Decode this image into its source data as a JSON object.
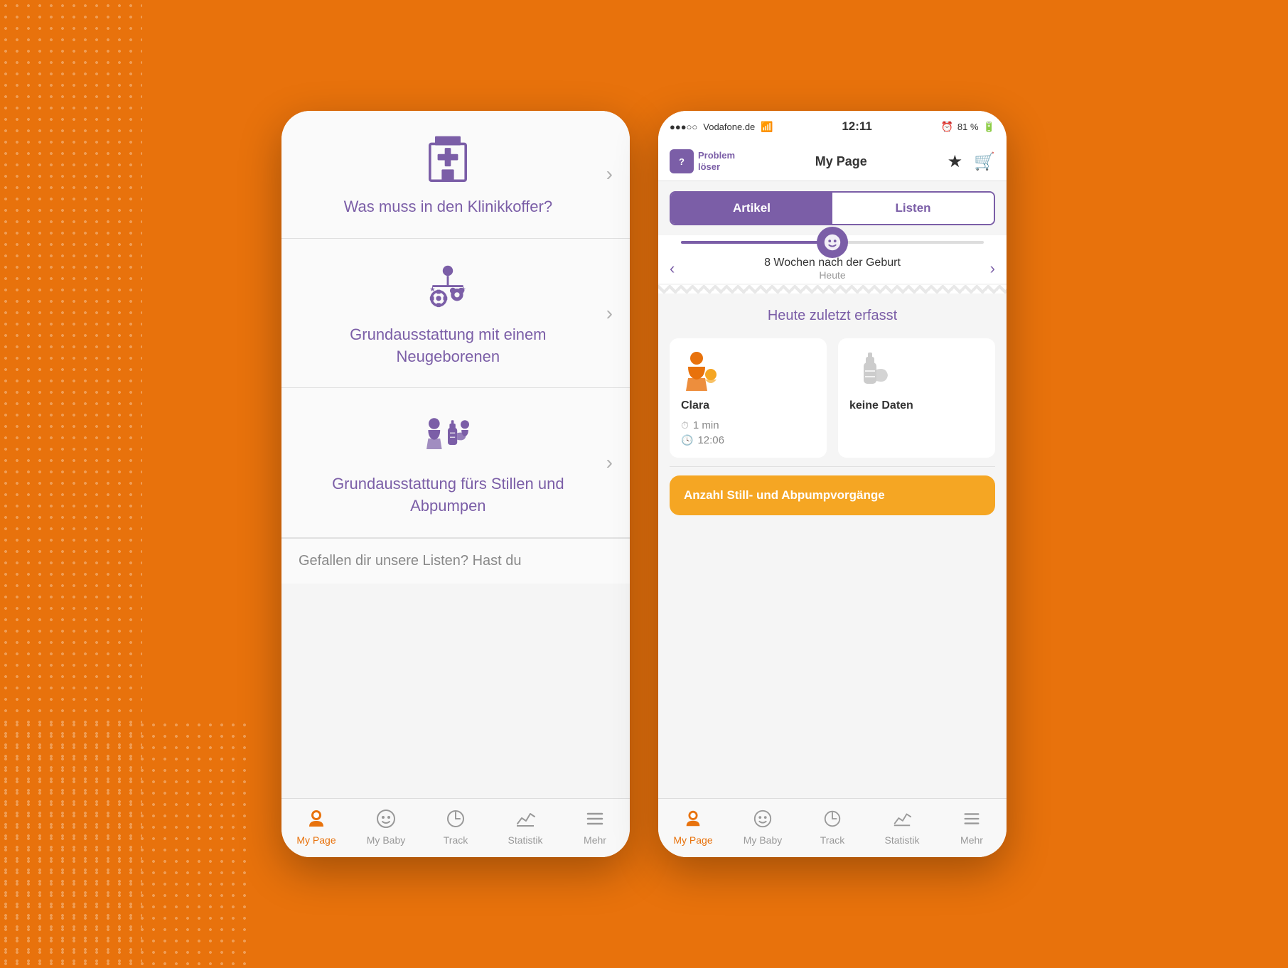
{
  "background_color": "#E8720C",
  "left_phone": {
    "items": [
      {
        "icon": "hospital",
        "label": "Was muss in den\nKlinikkoffer?"
      },
      {
        "icon": "baby-mobile",
        "label": "Grundausstattung mit\neinem Neugeborenen"
      },
      {
        "icon": "breastpump",
        "label": "Grundausstattung fürs\nStillen und Abpumpen"
      }
    ],
    "bottom_text": "Gefallen dir unsere Listen? Hast du",
    "nav": {
      "items": [
        {
          "label": "My Page",
          "active": true
        },
        {
          "label": "My Baby",
          "active": false
        },
        {
          "label": "Track",
          "active": false
        },
        {
          "label": "Statistik",
          "active": false
        },
        {
          "label": "Mehr",
          "active": false
        }
      ]
    }
  },
  "right_phone": {
    "status_bar": {
      "carrier": "●●●○○ Vodafone.de",
      "wifi": "wifi",
      "time": "12:11",
      "battery_icon": "🔋",
      "battery_percent": "81 %"
    },
    "header": {
      "logo_text_line1": "Problem",
      "logo_text_line2": "löser",
      "title": "My Page",
      "star_icon": "star",
      "cart_icon": "cart"
    },
    "tabs": [
      {
        "label": "Artikel",
        "active": true
      },
      {
        "label": "Listen",
        "active": false
      }
    ],
    "week_nav": {
      "prev_arrow": "‹",
      "next_arrow": "›",
      "title": "8 Wochen nach der Geburt",
      "subtitle": "Heute"
    },
    "today_section": {
      "title": "Heute zuletzt erfasst",
      "cards": [
        {
          "name": "Clara",
          "detail_time": "1 min",
          "detail_clock": "12:06",
          "icon_type": "nursing"
        },
        {
          "name": "keine Daten",
          "icon_type": "pump"
        }
      ]
    },
    "orange_card": {
      "title": "Anzahl Still- und\nAbpumpvorgänge"
    }
  }
}
